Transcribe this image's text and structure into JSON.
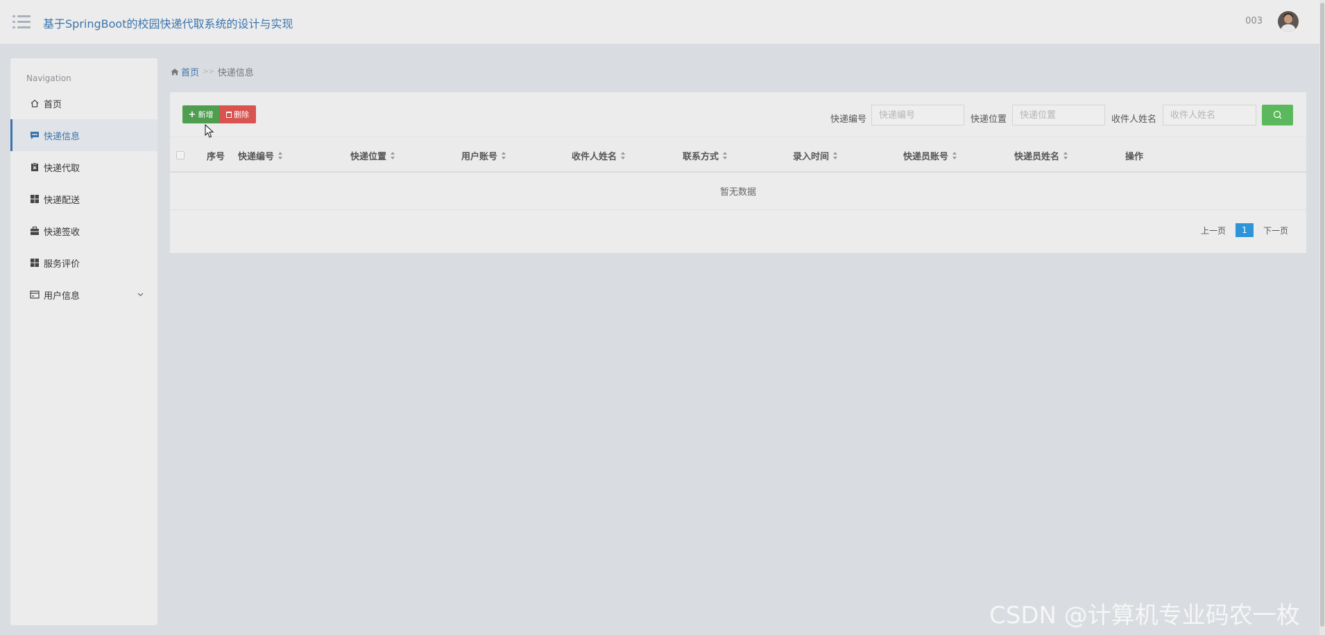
{
  "header": {
    "title": "基于SpringBoot的校园快递代取系统的设计与实现",
    "user_name": "003"
  },
  "sidebar": {
    "heading": "Navigation",
    "items": [
      {
        "label": "首页",
        "icon": "home-icon"
      },
      {
        "label": "快递信息",
        "icon": "chat-icon",
        "active": true
      },
      {
        "label": "快递代取",
        "icon": "clipboard-icon"
      },
      {
        "label": "快递配送",
        "icon": "grid-icon"
      },
      {
        "label": "快递签收",
        "icon": "briefcase-icon"
      },
      {
        "label": "服务评价",
        "icon": "grid-icon"
      },
      {
        "label": "用户信息",
        "icon": "card-icon",
        "expandable": true
      }
    ]
  },
  "breadcrumb": {
    "home": "首页",
    "separator": ">>",
    "current": "快递信息"
  },
  "toolbar": {
    "add_label": "新增",
    "delete_label": "删除"
  },
  "filters": [
    {
      "label": "快递编号",
      "placeholder": "快递编号"
    },
    {
      "label": "快递位置",
      "placeholder": "快递位置"
    },
    {
      "label": "收件人姓名",
      "placeholder": "收件人姓名"
    }
  ],
  "table": {
    "columns": [
      "序号",
      "快递编号",
      "快递位置",
      "用户账号",
      "收件人姓名",
      "联系方式",
      "录入时间",
      "快递员账号",
      "快递员姓名",
      "操作"
    ],
    "empty_text": "暂无数据"
  },
  "pagination": {
    "prev": "上一页",
    "current": "1",
    "next": "下一页"
  },
  "watermark": "CSDN @计算机专业码农一枚",
  "colors": {
    "accent": "#3b74ad",
    "add_button": "#4f9d4f",
    "delete_button": "#d9534f",
    "search_button": "#5cb85c",
    "page_active": "#2d94d8"
  }
}
